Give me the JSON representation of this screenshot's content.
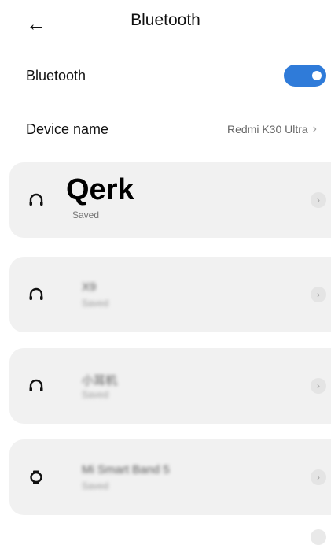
{
  "header": {
    "title": "Bluetooth",
    "back_icon": "arrow-left-icon"
  },
  "settings": {
    "bluetooth_label": "Bluetooth",
    "bluetooth_enabled": true,
    "device_name_label": "Device name",
    "device_name_value": "Redmi K30 Ultra"
  },
  "devices": [
    {
      "name": "Qerk",
      "status": "Saved",
      "icon": "headphones-icon"
    },
    {
      "name": "X9",
      "status": "Saved",
      "icon": "headphones-icon"
    },
    {
      "name": "小耳机",
      "status": "Saved",
      "icon": "headphones-icon"
    },
    {
      "name": "Mi Smart Band 5",
      "status": "Saved",
      "icon": "watch-icon"
    }
  ],
  "colors": {
    "accent": "#2f7bd9",
    "card_bg": "#f1f1f1"
  }
}
